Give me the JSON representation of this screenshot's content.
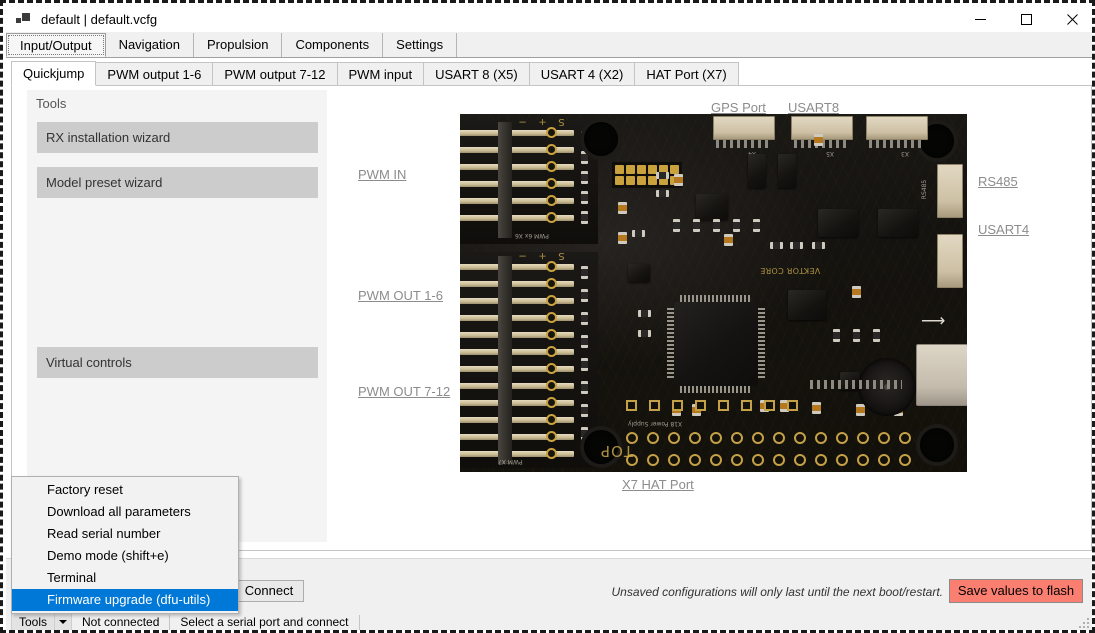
{
  "window": {
    "title": "default | default.vcfg",
    "icon": "app-icon",
    "minimize_label": "–",
    "maximize_label": "□",
    "close_label": "✕"
  },
  "menu_tabs": [
    {
      "label": "Input/Output",
      "selected": true
    },
    {
      "label": "Navigation",
      "selected": false
    },
    {
      "label": "Propulsion",
      "selected": false
    },
    {
      "label": "Components",
      "selected": false
    },
    {
      "label": "Settings",
      "selected": false
    }
  ],
  "sub_tabs": [
    {
      "label": "Quickjump",
      "selected": true
    },
    {
      "label": "PWM output 1-6",
      "selected": false
    },
    {
      "label": "PWM output 7-12",
      "selected": false
    },
    {
      "label": "PWM input",
      "selected": false
    },
    {
      "label": "USART 8 (X5)",
      "selected": false
    },
    {
      "label": "USART 4 (X2)",
      "selected": false
    },
    {
      "label": "HAT Port (X7)",
      "selected": false
    }
  ],
  "tools_panel": {
    "header": "Tools",
    "buttons": [
      {
        "label": "RX installation wizard"
      },
      {
        "label": "Model preset wizard"
      },
      {
        "label": "Virtual controls"
      }
    ]
  },
  "pcb_links": {
    "gps_port": "GPS Port",
    "usart8": "USART8",
    "rs485": "RS485",
    "usart4": "USART4",
    "pwm_in": "PWM IN",
    "pwm_out_1_6": "PWM OUT 1-6",
    "pwm_out_7_12": "PWM OUT 7-12",
    "x7_hat_port": "X7 HAT Port"
  },
  "pcb_silkscreen": {
    "top": "TOP",
    "x18_power_supply": "X18 Power Supply",
    "pwm_6x_x6": "PWM 6x  X6",
    "pwm_x7": "PWM X7",
    "vektor_core": "VEKTOR CORE",
    "minus": "−",
    "plus": "+",
    "signal": "S"
  },
  "bottom_bar": {
    "connect_label": "Connect",
    "unsaved_note": "Unsaved configurations will only last until the next boot/restart.",
    "save_flash_label": "Save values to flash",
    "save_flash_color": "#fb7f71"
  },
  "status_bar": {
    "tools_label": "Tools",
    "connection_status": "Not connected",
    "hint": "Select a serial port and connect"
  },
  "context_menu": {
    "items": [
      {
        "label": "Factory reset",
        "highlighted": false
      },
      {
        "label": "Download all parameters",
        "highlighted": false
      },
      {
        "label": "Read serial number",
        "highlighted": false
      },
      {
        "label": "Demo mode (shift+e)",
        "highlighted": false
      },
      {
        "label": "Terminal",
        "highlighted": false
      },
      {
        "label": "Firmware upgrade (dfu-utils)",
        "highlighted": true
      }
    ],
    "highlight_color": "#0078d7"
  }
}
